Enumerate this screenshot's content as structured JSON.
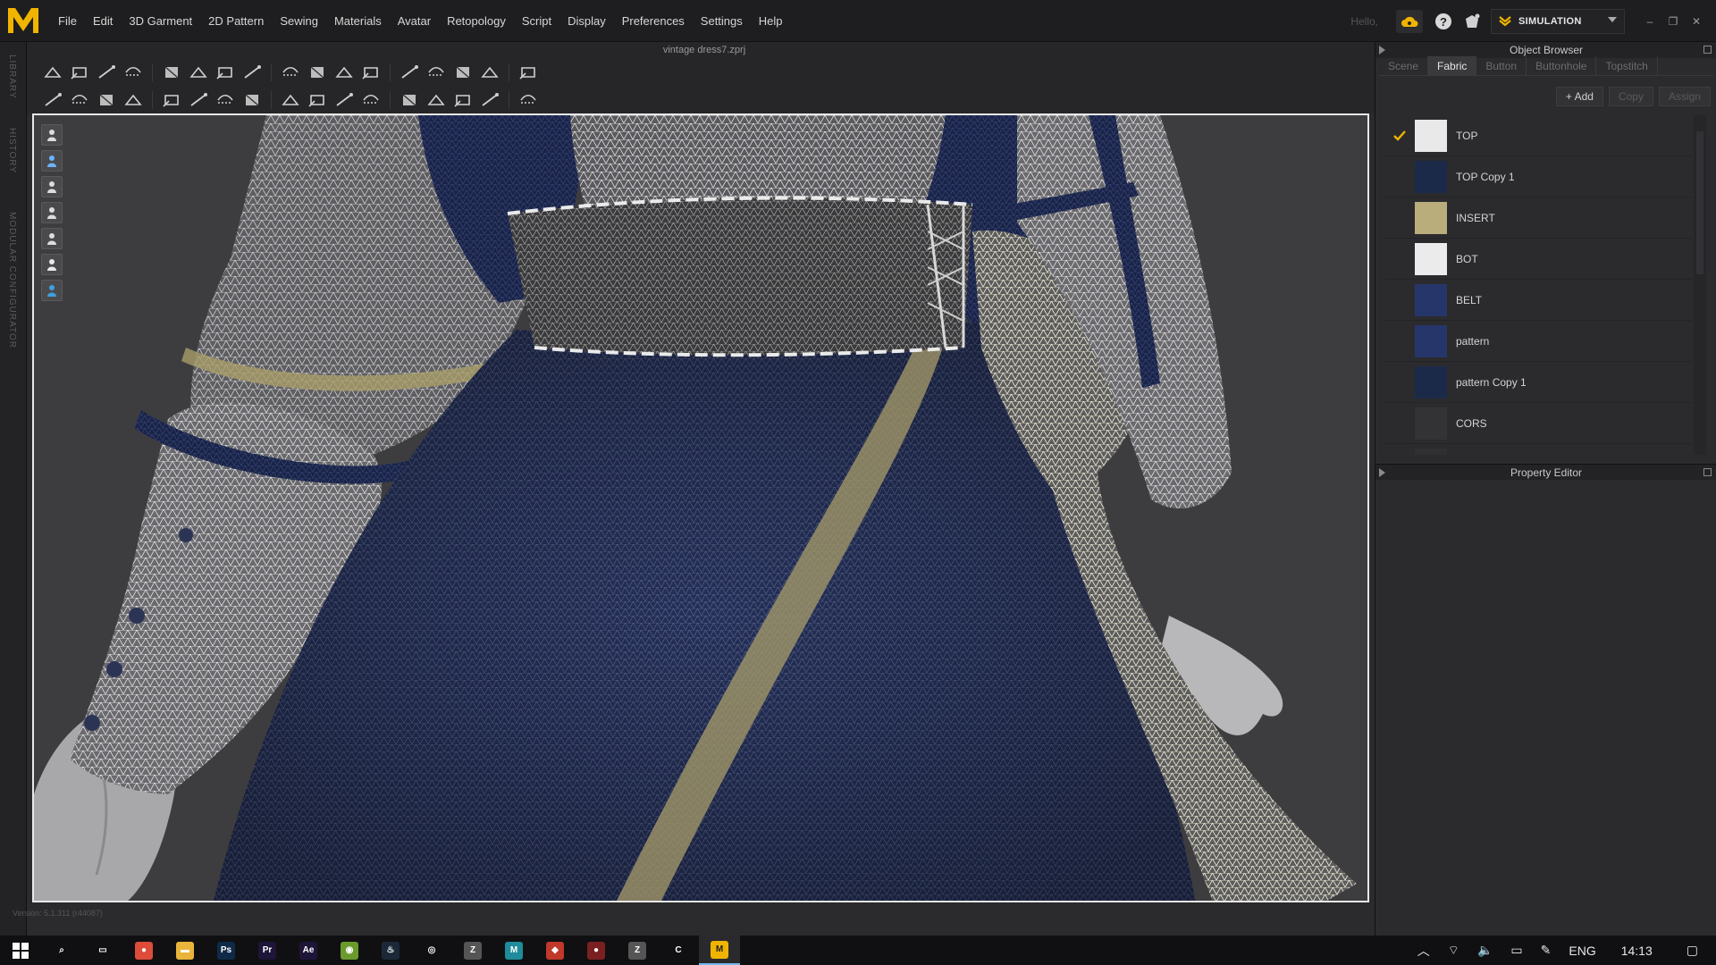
{
  "app": {
    "logo_letter": "M",
    "file_title": "vintage dress7.zprj",
    "menus": [
      "File",
      "Edit",
      "3D Garment",
      "2D Pattern",
      "Sewing",
      "Materials",
      "Avatar",
      "Retopology",
      "Script",
      "Display",
      "Preferences",
      "Settings",
      "Help"
    ],
    "hello_text": "Hello,",
    "mode_label": "SIMULATION",
    "accent_color": "#f0b400",
    "version_text": "Version: 5.1.311 (r44087)"
  },
  "left_tabs": [
    "LIBRARY",
    "HISTORY",
    "MODULAR CONFIGURATOR"
  ],
  "toolbar": {
    "row1_icons": [
      "select-move-icon",
      "transform-icon",
      "fold-arrangement-icon",
      "bounding-box-icon",
      "edit-curvature-icon",
      "sew-segment-icon",
      "free-sew-icon",
      "m-n-sew-icon",
      "edit-sewing-icon",
      "tack-icon",
      "pin-icon",
      "fold-icon",
      "strap-icon",
      "arrangement-icon",
      "drape-icon",
      "grid-icon",
      "grid-2-icon"
    ],
    "row2_icons": [
      "avatar-measure-icon",
      "circumference-icon",
      "length-icon",
      "brush-icon",
      "texture-icon",
      "graphic-icon",
      "topstitch-icon",
      "seam-icon",
      "puckering-icon",
      "button-icon",
      "buttonhole-icon",
      "zipper-icon",
      "tape-icon",
      "shirring-icon",
      "trim-icon",
      "fit-icon",
      "align-icon"
    ]
  },
  "viewport_tools": [
    "display-garment-icon",
    "display-avatar-icon",
    "avatar-icon",
    "texture-view-icon",
    "wireframe-icon",
    "skin-icon",
    "environment-icon"
  ],
  "view_modes": [
    "split-view",
    "3D",
    "2D"
  ],
  "object_browser": {
    "title": "Object Browser",
    "tabs": [
      "Scene",
      "Fabric",
      "Button",
      "Buttonhole",
      "Topstitch"
    ],
    "active_tab": "Fabric",
    "actions": {
      "add": "+ Add",
      "copy": "Copy",
      "assign": "Assign"
    },
    "fabrics": [
      {
        "name": "TOP",
        "color": "#e9e9e9",
        "checked": true
      },
      {
        "name": "TOP Copy 1",
        "color": "#1c2a4a",
        "checked": false
      },
      {
        "name": "INSERT",
        "color": "#b9ad7b",
        "checked": false
      },
      {
        "name": "BOT",
        "color": "#ebebeb",
        "checked": false
      },
      {
        "name": "BELT",
        "color": "#26366a",
        "checked": false
      },
      {
        "name": "pattern",
        "color": "#26366a",
        "checked": false
      },
      {
        "name": "pattern Copy 1",
        "color": "#1c2a4a",
        "checked": false
      },
      {
        "name": "CORS",
        "color": "#333335",
        "checked": false
      },
      {
        "name": "",
        "color": "#303033",
        "checked": false
      }
    ]
  },
  "property_editor": {
    "title": "Property Editor"
  },
  "taskbar": {
    "apps": [
      {
        "name": "search",
        "label": "⌕",
        "color": "transparent"
      },
      {
        "name": "task-view",
        "label": "▭",
        "color": "transparent"
      },
      {
        "name": "chrome",
        "label": "●",
        "color": "#dd4b39"
      },
      {
        "name": "file-explorer",
        "label": "▬",
        "color": "#e8b43a"
      },
      {
        "name": "photoshop",
        "label": "Ps",
        "color": "#0f2a48"
      },
      {
        "name": "premiere",
        "label": "Pr",
        "color": "#1e1538"
      },
      {
        "name": "after-effects",
        "label": "Ae",
        "color": "#1e1538"
      },
      {
        "name": "app-green",
        "label": "◉",
        "color": "#6a9a2c"
      },
      {
        "name": "steam",
        "label": "♨",
        "color": "#1b2838"
      },
      {
        "name": "app-headset",
        "label": "◎",
        "color": "transparent"
      },
      {
        "name": "zbrush",
        "label": "Z",
        "color": "#555"
      },
      {
        "name": "marvelous-designer-alt",
        "label": "M",
        "color": "#1e8c9a"
      },
      {
        "name": "app-red",
        "label": "◆",
        "color": "#c0392b"
      },
      {
        "name": "app-dark-red",
        "label": "●",
        "color": "#7a2020"
      },
      {
        "name": "zbrush-2",
        "label": "Z",
        "color": "#555"
      },
      {
        "name": "cinema",
        "label": "C",
        "color": "transparent"
      },
      {
        "name": "marvelous-designer",
        "label": "M",
        "color": "#f0b400"
      }
    ],
    "active_app": "marvelous-designer",
    "language": "ENG",
    "time": "14:13"
  }
}
